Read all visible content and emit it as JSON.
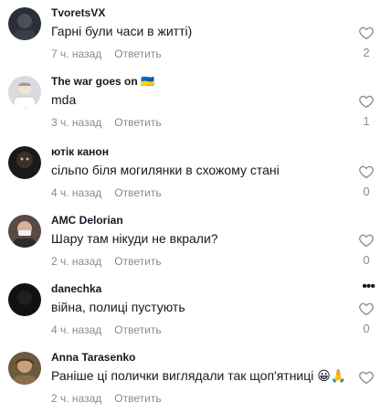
{
  "comments": [
    {
      "username": "TvoretsVX",
      "text": "Гарні були часи в житті)",
      "time": "7 ч. назад",
      "reply": "Ответить",
      "likes": "2"
    },
    {
      "username": "The war goes on 🇺🇦",
      "text": "mda",
      "time": "3 ч. назад",
      "reply": "Ответить",
      "likes": "1"
    },
    {
      "username": "ютік канон",
      "text": "сільпо біля могилянки в схожому стані",
      "time": "4 ч. назад",
      "reply": "Ответить",
      "likes": "0"
    },
    {
      "username": "AMC Delorian",
      "text": "Шару там нікуди не вкрали?",
      "time": "2 ч. назад",
      "reply": "Ответить",
      "likes": "0"
    },
    {
      "username": "danechka",
      "text": "війна, полиці пустують",
      "time": "4 ч. назад",
      "reply": "Ответить",
      "likes": "0",
      "more": "•••"
    },
    {
      "username": "Anna Tarasenko",
      "text": "Раніше ці полички виглядали так щоп'ятниці 😀🙏",
      "time": "2 ч. назад",
      "reply": "Ответить",
      "likes": ""
    }
  ],
  "icons": {
    "like": "heart-outline-icon",
    "more": "more-horizontal-icon"
  },
  "colors": {
    "text": "#161823",
    "secondary": "#8a8b91"
  }
}
